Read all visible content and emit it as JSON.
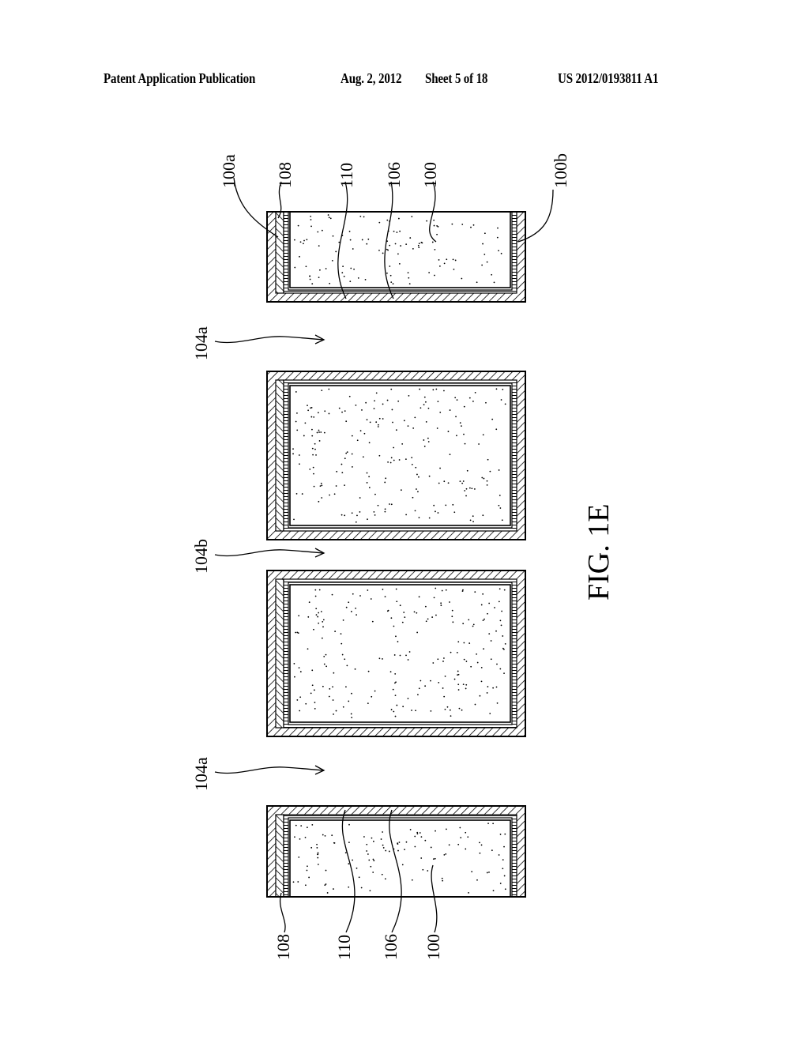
{
  "header": {
    "publication": "Patent Application Publication",
    "date": "Aug. 2, 2012",
    "sheet": "Sheet 5 of 18",
    "number": "US 2012/0193811 A1"
  },
  "figure": {
    "caption": "FIG. 1E",
    "orientation": "rotated 90° counter-clockwise",
    "blocks": [
      {
        "id": "block-top",
        "opening_side": "top",
        "labels": [
          "100a",
          "108",
          "110",
          "106",
          "100",
          "100b"
        ]
      },
      {
        "id": "block-mid-1",
        "opening_side": "none",
        "labels": []
      },
      {
        "id": "block-mid-2",
        "opening_side": "none",
        "labels": []
      },
      {
        "id": "block-bottom",
        "opening_side": "bottom",
        "labels": [
          "108",
          "110",
          "106",
          "100"
        ]
      }
    ],
    "gap_labels": [
      "104a",
      "104b",
      "104a"
    ],
    "top_labels": [
      "100a",
      "108",
      "110",
      "106",
      "100",
      "100b"
    ],
    "bottom_labels": [
      "108",
      "110",
      "106",
      "100"
    ]
  }
}
